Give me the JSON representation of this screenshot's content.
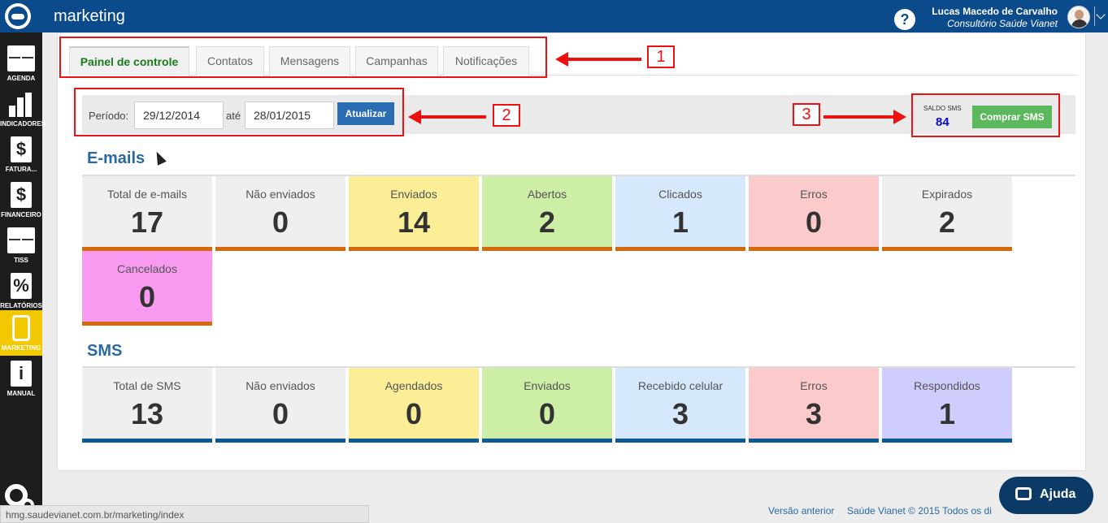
{
  "header": {
    "app_title": "marketing",
    "user_name": "Lucas Macedo de Carvalho",
    "user_org": "Consultório Saúde Vianet",
    "help": "?"
  },
  "sidebar": {
    "items": [
      {
        "label": "AGENDA"
      },
      {
        "label": "INDICADORES"
      },
      {
        "label": "FATURA..."
      },
      {
        "label": "FINANCEIRO"
      },
      {
        "label": "TISS"
      },
      {
        "label": "RELATÓRIOS"
      },
      {
        "label": "MARKETING"
      },
      {
        "label": "MANUAL"
      }
    ]
  },
  "tabs": [
    {
      "label": "Painel de controle"
    },
    {
      "label": "Contatos"
    },
    {
      "label": "Mensagens"
    },
    {
      "label": "Campanhas"
    },
    {
      "label": "Notificações"
    }
  ],
  "filter": {
    "period_label": "Período:",
    "start_date": "29/12/2014",
    "until_label": "até",
    "end_date": "28/01/2015",
    "update_button": "Atualizar",
    "sms_balance_label": "SALDO SMS",
    "sms_balance_value": "84",
    "buy_sms_button": "Comprar SMS"
  },
  "emails": {
    "title": "E-mails",
    "tiles": [
      {
        "label": "Total de e-mails",
        "value": "17",
        "bg": "#efefef"
      },
      {
        "label": "Não enviados",
        "value": "0",
        "bg": "#efefef"
      },
      {
        "label": "Enviados",
        "value": "14",
        "bg": "#fbee97"
      },
      {
        "label": "Abertos",
        "value": "2",
        "bg": "#cdeea5"
      },
      {
        "label": "Clicados",
        "value": "1",
        "bg": "#d6e8fb"
      },
      {
        "label": "Erros",
        "value": "0",
        "bg": "#fbcaca"
      },
      {
        "label": "Expirados",
        "value": "2",
        "bg": "#efefef"
      },
      {
        "label": "Cancelados",
        "value": "0",
        "bg": "#f89af0"
      }
    ],
    "bar_color": "#d56a0c"
  },
  "sms": {
    "title": "SMS",
    "tiles": [
      {
        "label": "Total de SMS",
        "value": "13",
        "bg": "#efefef"
      },
      {
        "label": "Não enviados",
        "value": "0",
        "bg": "#efefef"
      },
      {
        "label": "Agendados",
        "value": "0",
        "bg": "#fbee97"
      },
      {
        "label": "Enviados",
        "value": "0",
        "bg": "#cdeea5"
      },
      {
        "label": "Recebido celular",
        "value": "3",
        "bg": "#d6e8fb"
      },
      {
        "label": "Erros",
        "value": "3",
        "bg": "#fbcaca"
      },
      {
        "label": "Respondidos",
        "value": "1",
        "bg": "#cfcdfb"
      }
    ],
    "bar_color": "#0b5a96"
  },
  "annotations": [
    "1",
    "2",
    "3"
  ],
  "statusbar": {
    "url": "hmg.saudevianet.com.br/marketing/index"
  },
  "footer": {
    "previous_version": "Versão anterior",
    "copyright": "Saúde Vianet © 2015  Todos os di",
    "help_button": "Ajuda"
  }
}
